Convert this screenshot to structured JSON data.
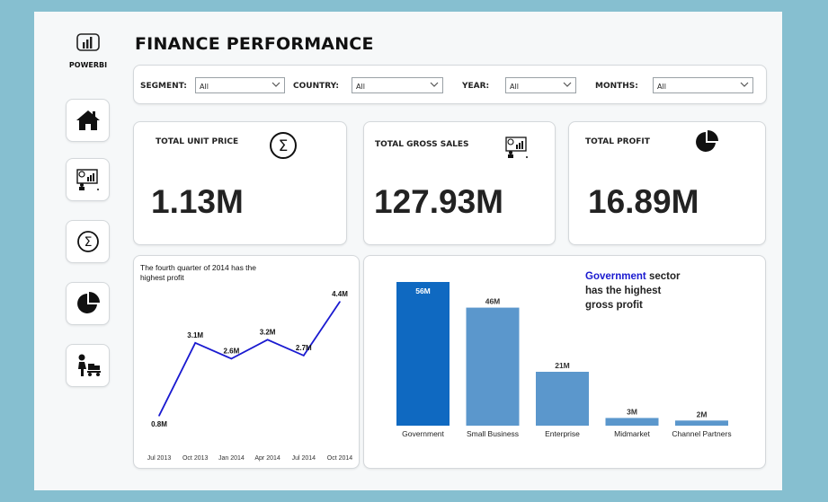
{
  "app": {
    "logo_text": "POWERBI",
    "title": "FINANCE PERFORMANCE"
  },
  "nav": [
    {
      "icon": "home-icon"
    },
    {
      "icon": "presentation-chart-icon"
    },
    {
      "icon": "sigma-icon"
    },
    {
      "icon": "pie-chart-icon"
    },
    {
      "icon": "worker-cart-icon"
    }
  ],
  "filters": [
    {
      "label": "SEGMENT:",
      "value": "All"
    },
    {
      "label": "COUNTRY:",
      "value": "All"
    },
    {
      "label": "YEAR:",
      "value": "All"
    },
    {
      "label": "MONTHS:",
      "value": "All"
    }
  ],
  "kpis": [
    {
      "label": "TOTAL UNIT PRICE",
      "value": "1.13M",
      "icon": "sigma-icon"
    },
    {
      "label": "TOTAL GROSS SALES",
      "value": "127.93M",
      "icon": "presentation-chart-icon"
    },
    {
      "label": "TOTAL PROFIT",
      "value": "16.89M",
      "icon": "pie-chart-icon"
    }
  ],
  "line_card": {
    "title_line1": "The fourth quarter of 2014 has the",
    "title_line2": "highest profit"
  },
  "bar_card": {
    "annotation_highlight": "Government",
    "annotation_rest1": " sector",
    "annotation_line2": "has the highest",
    "annotation_line3": "gross profit"
  },
  "colors": {
    "line": "#1a1ad0",
    "bar_highlight": "#0f69c1",
    "bar": "#5b97cc",
    "highlight_text": "#1a1ad0"
  },
  "chart_data": [
    {
      "type": "line",
      "x": [
        "Jul 2013",
        "Oct 2013",
        "Jan 2014",
        "Apr 2014",
        "Jul 2014",
        "Oct 2014"
      ],
      "values": [
        0.8,
        3.1,
        2.6,
        3.2,
        2.7,
        4.4
      ],
      "labels": [
        "0.8M",
        "3.1M",
        "2.6M",
        "3.2M",
        "2.7M",
        "4.4M"
      ],
      "ylim": [
        0,
        4.6
      ]
    },
    {
      "type": "bar",
      "categories": [
        "Government",
        "Small Business",
        "Enterprise",
        "Midmarket",
        "Channel Partners"
      ],
      "values": [
        56,
        46,
        21,
        3,
        2
      ],
      "labels": [
        "56M",
        "46M",
        "21M",
        "3M",
        "2M"
      ],
      "highlight_index": 0
    }
  ]
}
